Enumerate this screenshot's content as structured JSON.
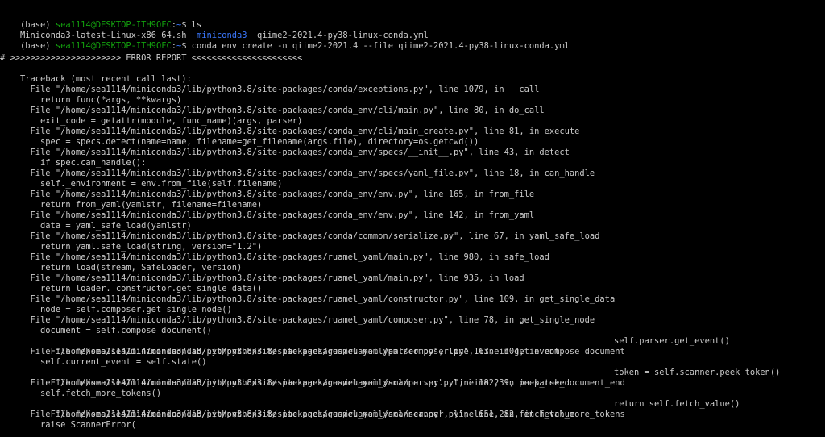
{
  "colors": {
    "background": "#000000",
    "foreground": "#cccccc",
    "prompt_user": "#13a10e",
    "prompt_path": "#3b78ff",
    "directory": "#3b78ff"
  },
  "prompt": {
    "env": "(base) ",
    "user_host": "sea1114@DESKTOP-ITH9OFC",
    "separator": ":",
    "path": "~",
    "symbol": "$ "
  },
  "commands": {
    "ls": "ls",
    "create": "conda env create -n qiime2-2021.4 --file qiime2-2021.4-py38-linux-conda.yml"
  },
  "ls_output": {
    "file1": "Miniconda3-latest-Linux-x86_64.sh  ",
    "dir1": "miniconda3",
    "file2": "  qiime2-2021.4-py38-linux-conda.yml"
  },
  "error_header": "# >>>>>>>>>>>>>>>>>>>>>> ERROR REPORT <<<<<<<<<<<<<<<<<<<<<<",
  "traceback_lines": [
    "    Traceback (most recent call last):",
    "      File \"/home/sea1114/miniconda3/lib/python3.8/site-packages/conda/exceptions.py\", line 1079, in __call__",
    "        return func(*args, **kwargs)",
    "      File \"/home/sea1114/miniconda3/lib/python3.8/site-packages/conda_env/cli/main.py\", line 80, in do_call",
    "        exit_code = getattr(module, func_name)(args, parser)",
    "      File \"/home/sea1114/miniconda3/lib/python3.8/site-packages/conda_env/cli/main_create.py\", line 81, in execute",
    "        spec = specs.detect(name=name, filename=get_filename(args.file), directory=os.getcwd())",
    "      File \"/home/sea1114/miniconda3/lib/python3.8/site-packages/conda_env/specs/__init__.py\", line 43, in detect",
    "        if spec.can_handle():",
    "      File \"/home/sea1114/miniconda3/lib/python3.8/site-packages/conda_env/specs/yaml_file.py\", line 18, in can_handle",
    "        self._environment = env.from_file(self.filename)",
    "      File \"/home/sea1114/miniconda3/lib/python3.8/site-packages/conda_env/env.py\", line 165, in from_file",
    "        return from_yaml(yamlstr, filename=filename)",
    "      File \"/home/sea1114/miniconda3/lib/python3.8/site-packages/conda_env/env.py\", line 142, in from_yaml",
    "        data = yaml_safe_load(yamlstr)",
    "      File \"/home/sea1114/miniconda3/lib/python3.8/site-packages/conda/common/serialize.py\", line 67, in yaml_safe_load",
    "        return yaml.safe_load(string, version=\"1.2\")",
    "      File \"/home/sea1114/miniconda3/lib/python3.8/site-packages/ruamel_yaml/main.py\", line 980, in safe_load",
    "        return load(stream, SafeLoader, version)",
    "      File \"/home/sea1114/miniconda3/lib/python3.8/site-packages/ruamel_yaml/main.py\", line 935, in load",
    "        return loader._constructor.get_single_data()",
    "      File \"/home/sea1114/miniconda3/lib/python3.8/site-packages/ruamel_yaml/constructor.py\", line 109, in get_single_data",
    "        node = self.composer.get_single_node()",
    "      File \"/home/sea1114/miniconda3/lib/python3.8/site-packages/ruamel_yaml/composer.py\", line 78, in get_single_node",
    "        document = self.compose_document()",
    "      File \"/home/sea1114/miniconda3/lib/python3.8/site-packages/ruamel_yaml/composer.py\", line 104, in compose_document",
    "        self.parser.get_event()",
    "      File \"/home/sea1114/miniconda3/lib/python3.8/site-packages/ruamel_yaml/parser.py\", line 163, in get_event",
    "        self.current_event = self.state()",
    "      File \"/home/sea1114/miniconda3/lib/python3.8/site-packages/ruamel_yaml/parser.py\", line 239, in parse_document_end",
    "        token = self.scanner.peek_token()",
    "      File \"/home/sea1114/miniconda3/lib/python3.8/site-packages/ruamel_yaml/scanner.py\", line 182, in peek_token",
    "        self.fetch_more_tokens()",
    "      File \"/home/sea1114/miniconda3/lib/python3.8/site-packages/ruamel_yaml/scanner.py\", line 282, in fetch_more_tokens",
    "        return self.fetch_value()",
    "      File \"/home/sea1114/miniconda3/lib/python3.8/site-packages/ruamel_yaml/scanner.py\", line 651, in fetch_value",
    "        raise ScannerError("
  ]
}
